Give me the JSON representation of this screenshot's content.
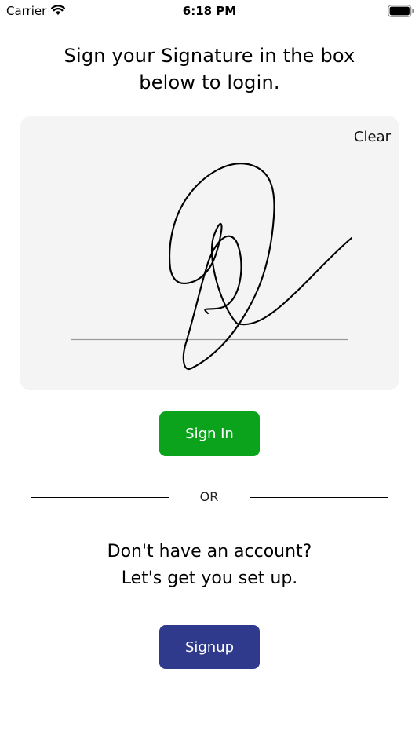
{
  "status_bar": {
    "carrier": "Carrier",
    "time": "6:18 PM",
    "wifi_icon": "wifi-icon",
    "battery_icon": "battery-icon"
  },
  "heading": {
    "line1": "Sign your Signature in the box",
    "line2": "below to login."
  },
  "signature_pad": {
    "clear_label": "Clear",
    "background": "#f4f4f4"
  },
  "actions": {
    "signin_label": "Sign In",
    "signin_color": "#0ca31c",
    "divider_label": "OR",
    "signup_prompt_line1": "Don't have an account?",
    "signup_prompt_line2": "Let's get you set up.",
    "signup_label": "Signup",
    "signup_color": "#2f3a8d"
  }
}
